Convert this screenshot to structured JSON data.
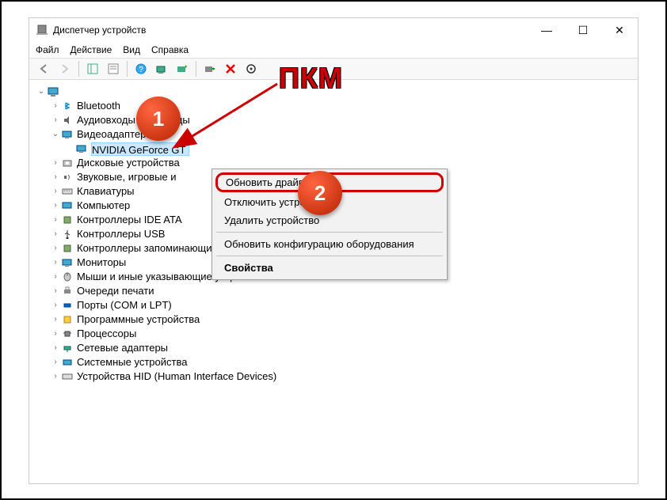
{
  "window": {
    "title": "Диспетчер устройств"
  },
  "winControls": {
    "min": "—",
    "max": "☐",
    "close": "✕"
  },
  "menu": {
    "file": "Файл",
    "action": "Действие",
    "view": "Вид",
    "help": "Справка"
  },
  "tree": {
    "root": "",
    "bluetooth": "Bluetooth",
    "audio": "Аудиовходы",
    "audio_suffix": "ды",
    "videoAdapters": "Видеоадаптеры",
    "nvidia": "NVIDIA GeForce GT",
    "diskDrives": "Дисковые устройства",
    "soundGame": "Звуковые, игровые и",
    "keyboards": "Клавиатуры",
    "computer": "Компьютер",
    "ideAta": "Контроллеры IDE ATA",
    "usb": "Контроллеры USB",
    "storage": "Контроллеры запоминающих устройств",
    "monitors": "Мониторы",
    "mice": "Мыши и иные указывающие устройства",
    "printQueues": "Очереди печати",
    "ports": "Порты (COM и LPT)",
    "software": "Программные устройства",
    "processors": "Процессоры",
    "netAdapters": "Сетевые адаптеры",
    "system": "Системные устройства",
    "hid": "Устройства HID (Human Interface Devices)"
  },
  "contextMenu": {
    "updateDriver": "Обновить драйвер",
    "disable": "Отключить устройств",
    "remove": "Удалить устройство",
    "refresh": "Обновить конфигурацию оборудования",
    "properties": "Свойства"
  },
  "annotations": {
    "one": "1",
    "two": "2",
    "label": "ПКМ"
  }
}
